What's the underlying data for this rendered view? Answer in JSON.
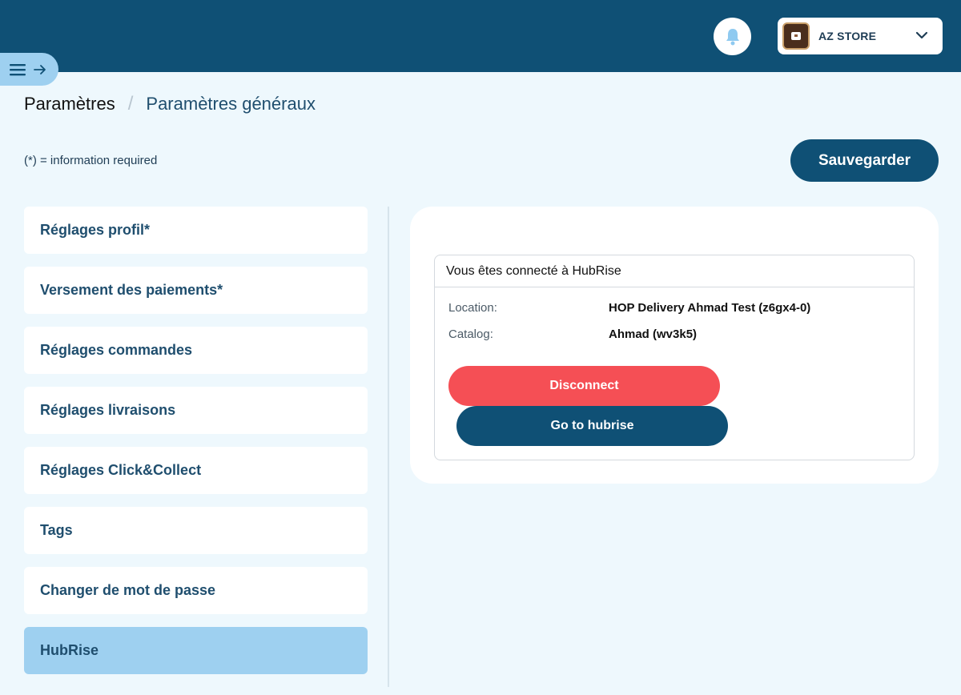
{
  "header": {
    "notification_icon": "bell-icon",
    "store": {
      "name": "AZ STORE",
      "dropdown_icon": "chevron-down-icon"
    }
  },
  "menu_toggle": {
    "icons": [
      "hamburger-icon",
      "arrow-right-icon"
    ]
  },
  "breadcrumb": {
    "root": "Paramètres",
    "separator": "/",
    "current": "Paramètres généraux"
  },
  "required_note": "(*) = information required",
  "save_label": "Sauvegarder",
  "settings_menu": {
    "items": [
      {
        "label": "Réglages profil*",
        "active": false
      },
      {
        "label": "Versement des paiements*",
        "active": false
      },
      {
        "label": "Réglages commandes",
        "active": false
      },
      {
        "label": "Réglages livraisons",
        "active": false
      },
      {
        "label": "Réglages Click&Collect",
        "active": false
      },
      {
        "label": "Tags",
        "active": false
      },
      {
        "label": "Changer de mot de passe",
        "active": false
      },
      {
        "label": "HubRise",
        "active": true
      }
    ]
  },
  "hubrise": {
    "title": "Vous êtes connecté à HubRise",
    "location_label": "Location:",
    "location_value": "HOP Delivery Ahmad Test (z6gx4-0)",
    "catalog_label": "Catalog:",
    "catalog_value": "Ahmad (wv3k5)",
    "disconnect_label": "Disconnect",
    "goto_label": "Go to hubrise"
  },
  "colors": {
    "topbar": "#0f5075",
    "background": "#eef8fd",
    "active_item": "#9ed0f0",
    "danger": "#f54f55",
    "primary": "#0f5075"
  }
}
